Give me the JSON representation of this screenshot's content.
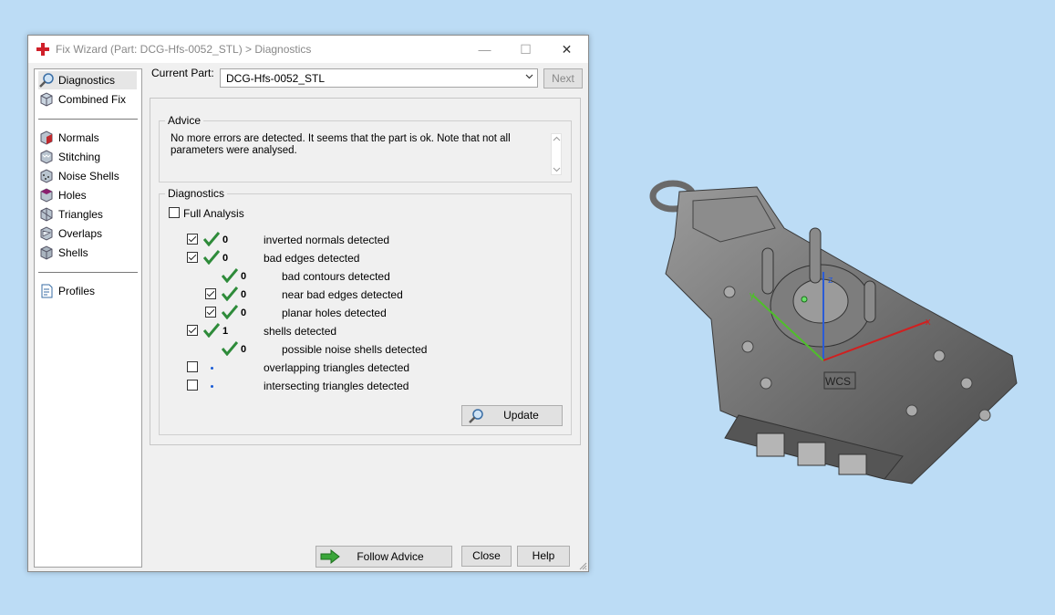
{
  "window": {
    "title": "Fix Wizard (Part: DCG-Hfs-0052_STL) > Diagnostics",
    "controls": {
      "minimize": "—",
      "maximize": "☐",
      "close": "✕"
    }
  },
  "nav": {
    "items": [
      {
        "label": "Diagnostics",
        "icon": "magnifier-icon"
      },
      {
        "label": "Combined Fix",
        "icon": "cube-icon"
      },
      {
        "label": "Normals",
        "icon": "normals-cube-icon"
      },
      {
        "label": "Stitching",
        "icon": "stitching-cube-icon"
      },
      {
        "label": "Noise Shells",
        "icon": "noise-shells-icon"
      },
      {
        "label": "Holes",
        "icon": "holes-cube-icon"
      },
      {
        "label": "Triangles",
        "icon": "triangles-cube-icon"
      },
      {
        "label": "Overlaps",
        "icon": "overlaps-cube-icon"
      },
      {
        "label": "Shells",
        "icon": "shells-cube-icon"
      },
      {
        "label": "Profiles",
        "icon": "profiles-document-icon"
      }
    ]
  },
  "current_part": {
    "label": "Current Part:",
    "value": "DCG-Hfs-0052_STL"
  },
  "next_label": "Next",
  "advice": {
    "title": "Advice",
    "text": "No more errors are detected. It seems that the part is ok. Note that not all parameters were analysed."
  },
  "diagnostics": {
    "title": "Diagnostics",
    "full_analysis": "Full Analysis",
    "rows": [
      {
        "count": "0",
        "text": "inverted normals detected"
      },
      {
        "count": "0",
        "text": "bad edges detected"
      },
      {
        "count": "0",
        "text": "bad contours detected"
      },
      {
        "count": "0",
        "text": "near bad edges detected"
      },
      {
        "count": "0",
        "text": "planar holes detected"
      },
      {
        "count": "1",
        "text": "shells detected"
      },
      {
        "count": "0",
        "text": "possible noise shells detected"
      },
      {
        "count": "",
        "text": "overlapping triangles detected"
      },
      {
        "count": "",
        "text": "intersecting triangles detected"
      }
    ],
    "update_label": "Update"
  },
  "buttons": {
    "follow_advice": "Follow Advice",
    "close": "Close",
    "help": "Help"
  },
  "viewport": {
    "wcs_label": "WCS",
    "axis_x": "x",
    "axis_y": "y",
    "axis_z": "z"
  },
  "colors": {
    "accent_red": "#d0202a",
    "check_green": "#2e8b3a",
    "dot_blue": "#1a5cd6"
  }
}
